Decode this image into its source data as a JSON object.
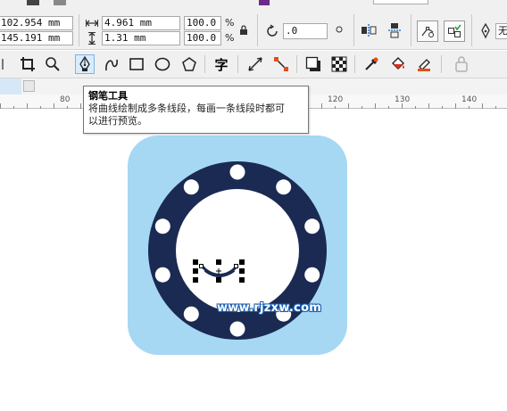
{
  "property_bar": {
    "x_value": "102.954 mm",
    "y_value": "145.191 mm",
    "width_value": "4.961 mm",
    "height_value": "1.31 mm",
    "scale_x": "100.0",
    "scale_y": "100.0",
    "percent_symbol": "%",
    "rotation_value": ".0",
    "no_fill_label": "无"
  },
  "toolbox": {
    "text_tool_glyph": "字",
    "active_tool": "pen-tool"
  },
  "ruler": {
    "ticks": [
      "80",
      "120",
      "130",
      "140"
    ]
  },
  "tooltip": {
    "title": "钢笔工具",
    "line1": "将曲线绘制成多条线段，每画一条线段时都可",
    "line2": "以进行预览。"
  },
  "artwork": {
    "background_color": "#a6d8f4",
    "ring_color": "#1b2a52",
    "dot_color": "#ffffff",
    "dot_count": 10
  },
  "watermark": {
    "text": "www.rjzxw.com"
  }
}
